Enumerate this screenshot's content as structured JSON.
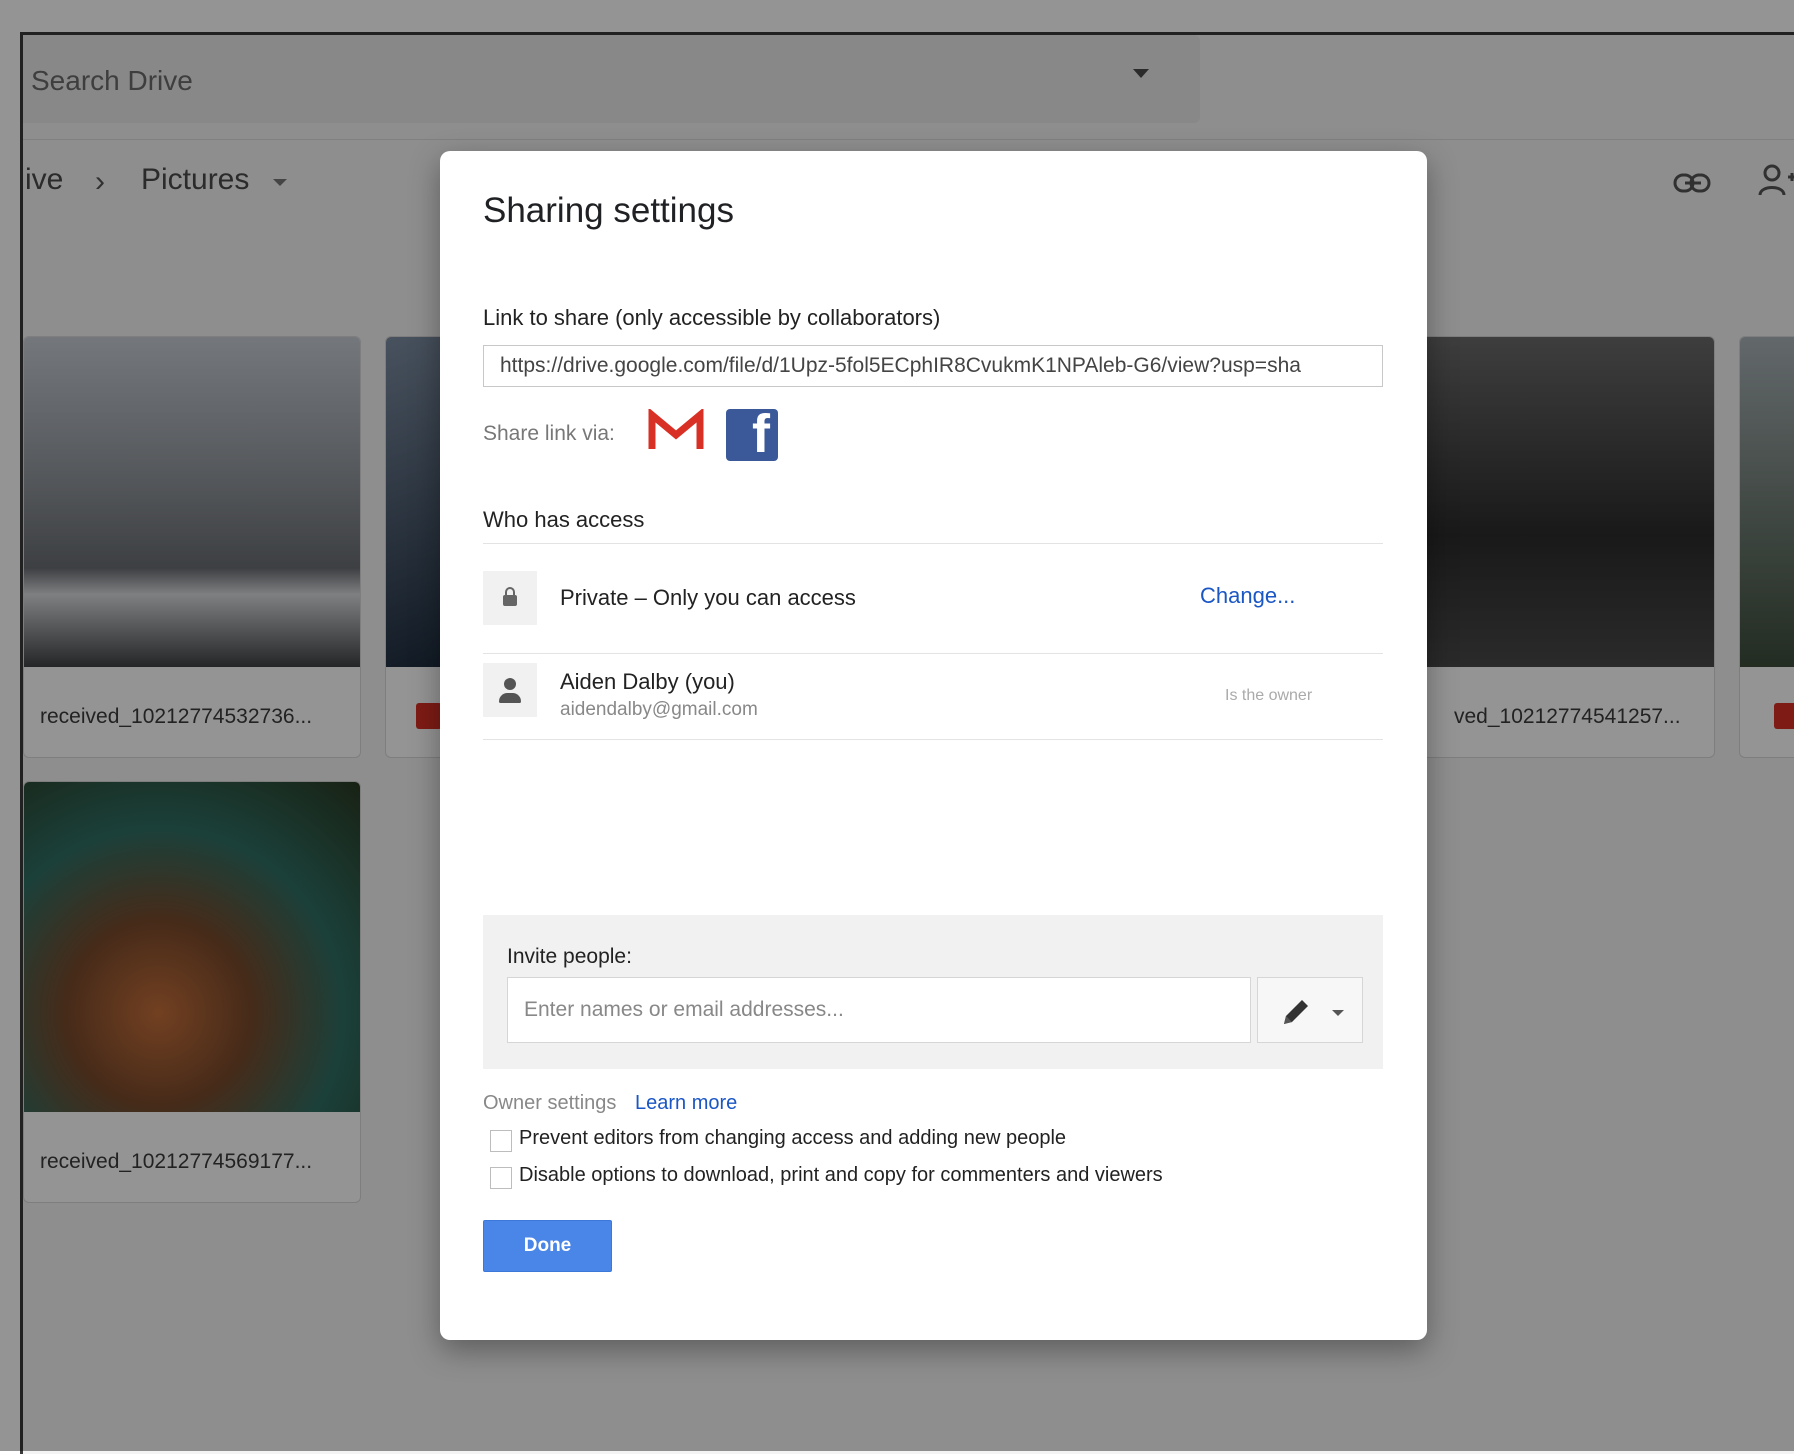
{
  "drive": {
    "search_placeholder": "Search Drive",
    "breadcrumb_parent": "ive",
    "breadcrumb_separator": "›",
    "breadcrumb_current": "Pictures",
    "files": [
      {
        "name": "received_10212774532736..."
      },
      {
        "name": "ved_10212774541257..."
      },
      {
        "name": "received_10212774569177..."
      }
    ]
  },
  "dialog": {
    "title": "Sharing settings",
    "link_label": "Link to share (only accessible by collaborators)",
    "link_value": "https://drive.google.com/file/d/1Upz-5fol5ECphIR8CvukmK1NPAleb-G6/view?usp=sha",
    "share_via_label": "Share link via:",
    "share_icons": [
      "gmail-icon",
      "facebook-icon"
    ],
    "who_has_access": "Who has access",
    "access": {
      "text": "Private – Only you can access",
      "change_label": "Change..."
    },
    "owner": {
      "name": "Aiden Dalby (you)",
      "email": "aidendalby@gmail.com",
      "role": "Is the owner"
    },
    "invite": {
      "label": "Invite people:",
      "placeholder": "Enter names or email addresses..."
    },
    "owner_settings_label": "Owner settings",
    "learn_more": "Learn more",
    "checkboxes": [
      {
        "label": "Prevent editors from changing access and adding new people",
        "checked": false
      },
      {
        "label": "Disable options to download, print and copy for commenters and viewers",
        "checked": false
      }
    ],
    "done_label": "Done"
  },
  "colors": {
    "accent_blue": "#4a86e8",
    "link_blue": "#1a56c4",
    "gmail_red": "#d93025",
    "facebook_blue": "#3b5998"
  }
}
